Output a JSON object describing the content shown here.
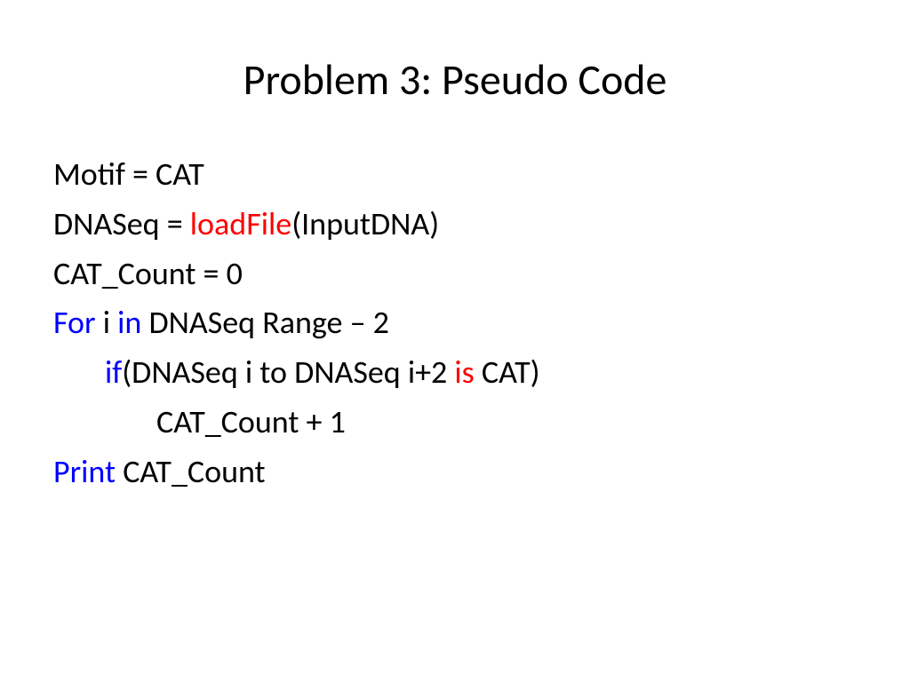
{
  "title": "Problem 3: Pseudo Code",
  "lines": {
    "l1": "Motif = CAT",
    "l2a": "DNASeq = ",
    "l2b": "loadFile",
    "l2c": "(InputDNA)",
    "l3": "CAT_Count = 0",
    "l4a": "For",
    "l4b": " i ",
    "l4c": "in",
    "l4d": " DNASeq Range – 2",
    "l5a": "if",
    "l5b": "(DNASeq i to DNASeq i+2 ",
    "l5c": "is",
    "l5d": " CAT)",
    "l6": "CAT_Count + 1",
    "l7a": "Print",
    "l7b": " CAT_Count"
  }
}
